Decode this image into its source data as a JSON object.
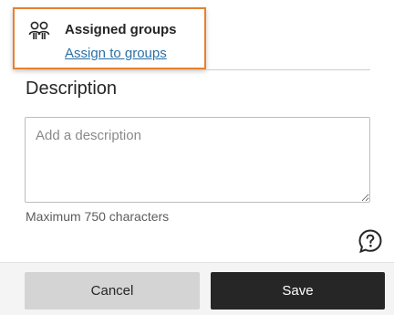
{
  "assigned_groups": {
    "title": "Assigned groups",
    "link_label": "Assign to groups",
    "icon": "groups-icon",
    "highlight_color": "#e8812e"
  },
  "description": {
    "heading": "Description",
    "placeholder": "Add a description",
    "value": "",
    "max_note": "Maximum 750 characters"
  },
  "help": {
    "icon": "help-icon"
  },
  "footer": {
    "cancel_label": "Cancel",
    "save_label": "Save",
    "save_color": "#262626",
    "cancel_color": "#d4d4d4"
  }
}
